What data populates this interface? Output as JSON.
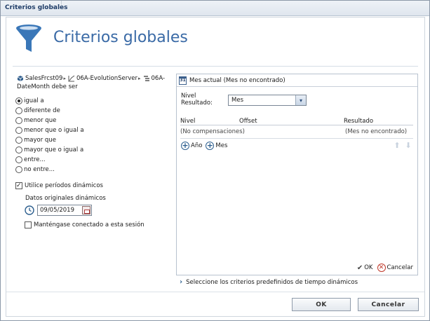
{
  "window": {
    "title": "Criterios globales"
  },
  "header": {
    "title": "Criterios globales",
    "icon": "funnel-icon"
  },
  "breadcrumb": {
    "items": [
      {
        "label": "SalesFrcst09",
        "icon": "cube-icon"
      },
      {
        "label": "06A-EvolutionServer",
        "icon": "chart-line-icon"
      },
      {
        "label": "06A-",
        "icon": "hierarchy-icon"
      }
    ],
    "line2": "DateMonth debe ser"
  },
  "operators": {
    "selected_index": 0,
    "items": [
      "igual a",
      "diferente de",
      "menor que",
      "menor que o igual a",
      "mayor que",
      "mayor que o igual a",
      "entre...",
      "no entre..."
    ]
  },
  "dynamic": {
    "use_label": "Utilice períodos dinámicos",
    "use_checked": true,
    "original_label": "Datos originales dinámicos",
    "date_value": "09/05/2019",
    "stay_connected_label": "Manténgase conectado a esta sesión",
    "stay_connected_checked": false
  },
  "right_panel": {
    "header": "Mes actual (Mes no encontrado)",
    "level_label_line1": "Nivel",
    "level_label_line2": "Resultado:",
    "level_value": "Mes",
    "table": {
      "columns": [
        "Nivel",
        "Offset",
        "Resultado"
      ],
      "rows": [
        {
          "nivel": "(No compensaciones)",
          "offset": "",
          "resultado": "(Mes no encontrado)"
        }
      ]
    },
    "add_year": "Año",
    "add_month": "Mes",
    "ok_label": "OK",
    "cancel_label": "Cancelar"
  },
  "predefined_link": "Seleccione los criterios predefinidos de tiempo dinámicos",
  "footer": {
    "ok_label": "OK",
    "cancel_label": "Cancelar"
  },
  "colors": {
    "accent": "#3a6aa6",
    "title_text": "#1f3d68"
  }
}
